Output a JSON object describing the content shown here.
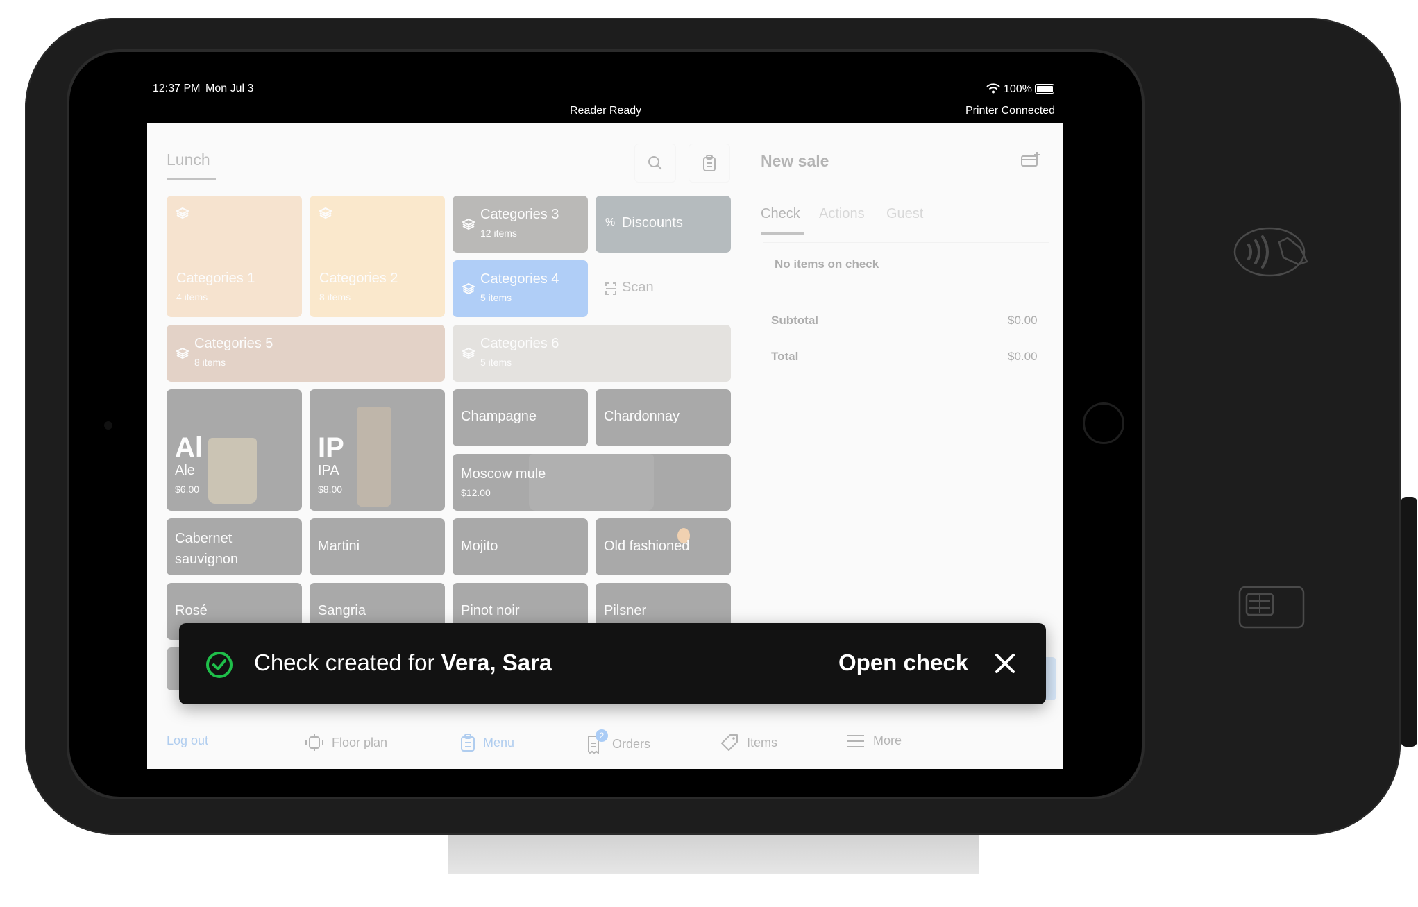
{
  "status_bar": {
    "time": "12:37 PM",
    "date": "Mon Jul 3",
    "battery": "100%",
    "reader_status": "Reader Ready",
    "printer_status": "Printer Connected"
  },
  "menu": {
    "title": "Lunch",
    "search_icon": "search-icon",
    "clipboard_icon": "clipboard-icon",
    "categories": [
      {
        "label": "Categories 1",
        "sub": "4 items",
        "color": "#f3cc9c"
      },
      {
        "label": "Categories 2",
        "sub": "8 items",
        "color": "#fbd397"
      },
      {
        "label": "Categories 3",
        "sub": "12 items",
        "color": "#6d6a66"
      },
      {
        "label": "Discounts",
        "sub": "",
        "color": "#5d6a72"
      },
      {
        "label": "Categories 4",
        "sub": "5 items",
        "color": "#4f95f0"
      },
      {
        "label": "Scan",
        "sub": "",
        "color": ""
      },
      {
        "label": "Categories 5",
        "sub": "8 items",
        "color": "#c9a58a"
      },
      {
        "label": "Categories 6",
        "sub": "5 items",
        "color": "#c9c4be"
      }
    ],
    "products": [
      {
        "abbr": "Al",
        "label": "Ale",
        "price": "$6.00"
      },
      {
        "abbr": "IP",
        "label": "IPA",
        "price": "$8.00"
      },
      {
        "label": "Champagne"
      },
      {
        "label": "Chardonnay"
      },
      {
        "label": "Moscow mule",
        "price": "$12.00"
      },
      {
        "label": "Cabernet sauvignon"
      },
      {
        "label": "Martini"
      },
      {
        "label": "Mojito"
      },
      {
        "label": "Old fashioned"
      },
      {
        "label": "Rosé"
      },
      {
        "label": "Sangria"
      },
      {
        "label": "Pinot noir"
      },
      {
        "label": "Pilsner"
      }
    ]
  },
  "check_panel": {
    "title": "New sale",
    "new_check_icon": "new-check-icon",
    "tabs": [
      {
        "label": "Check",
        "active": true
      },
      {
        "label": "Actions",
        "active": false
      },
      {
        "label": "Guest",
        "active": false
      }
    ],
    "empty_message": "No items on check",
    "subtotal_label": "Subtotal",
    "subtotal_value": "$0.00",
    "total_label": "Total",
    "total_value": "$0.00"
  },
  "bottom_nav": {
    "items": [
      {
        "label": "Log out",
        "icon": ""
      },
      {
        "label": "Floor plan",
        "icon": "floor-plan-icon"
      },
      {
        "label": "Menu",
        "icon": "menu-icon",
        "active": true
      },
      {
        "label": "Orders",
        "icon": "orders-icon",
        "badge": "2"
      },
      {
        "label": "Items",
        "icon": "tag-icon"
      },
      {
        "label": "More",
        "icon": "hamburger-icon"
      }
    ]
  },
  "toast": {
    "message_prefix": "Check created for ",
    "guest_name": "Vera, Sara",
    "action_label": "Open check",
    "success_color": "#1fbf4a"
  },
  "colors": {
    "accent_blue": "#3d8ef0",
    "device_body": "#1d1d1d"
  }
}
